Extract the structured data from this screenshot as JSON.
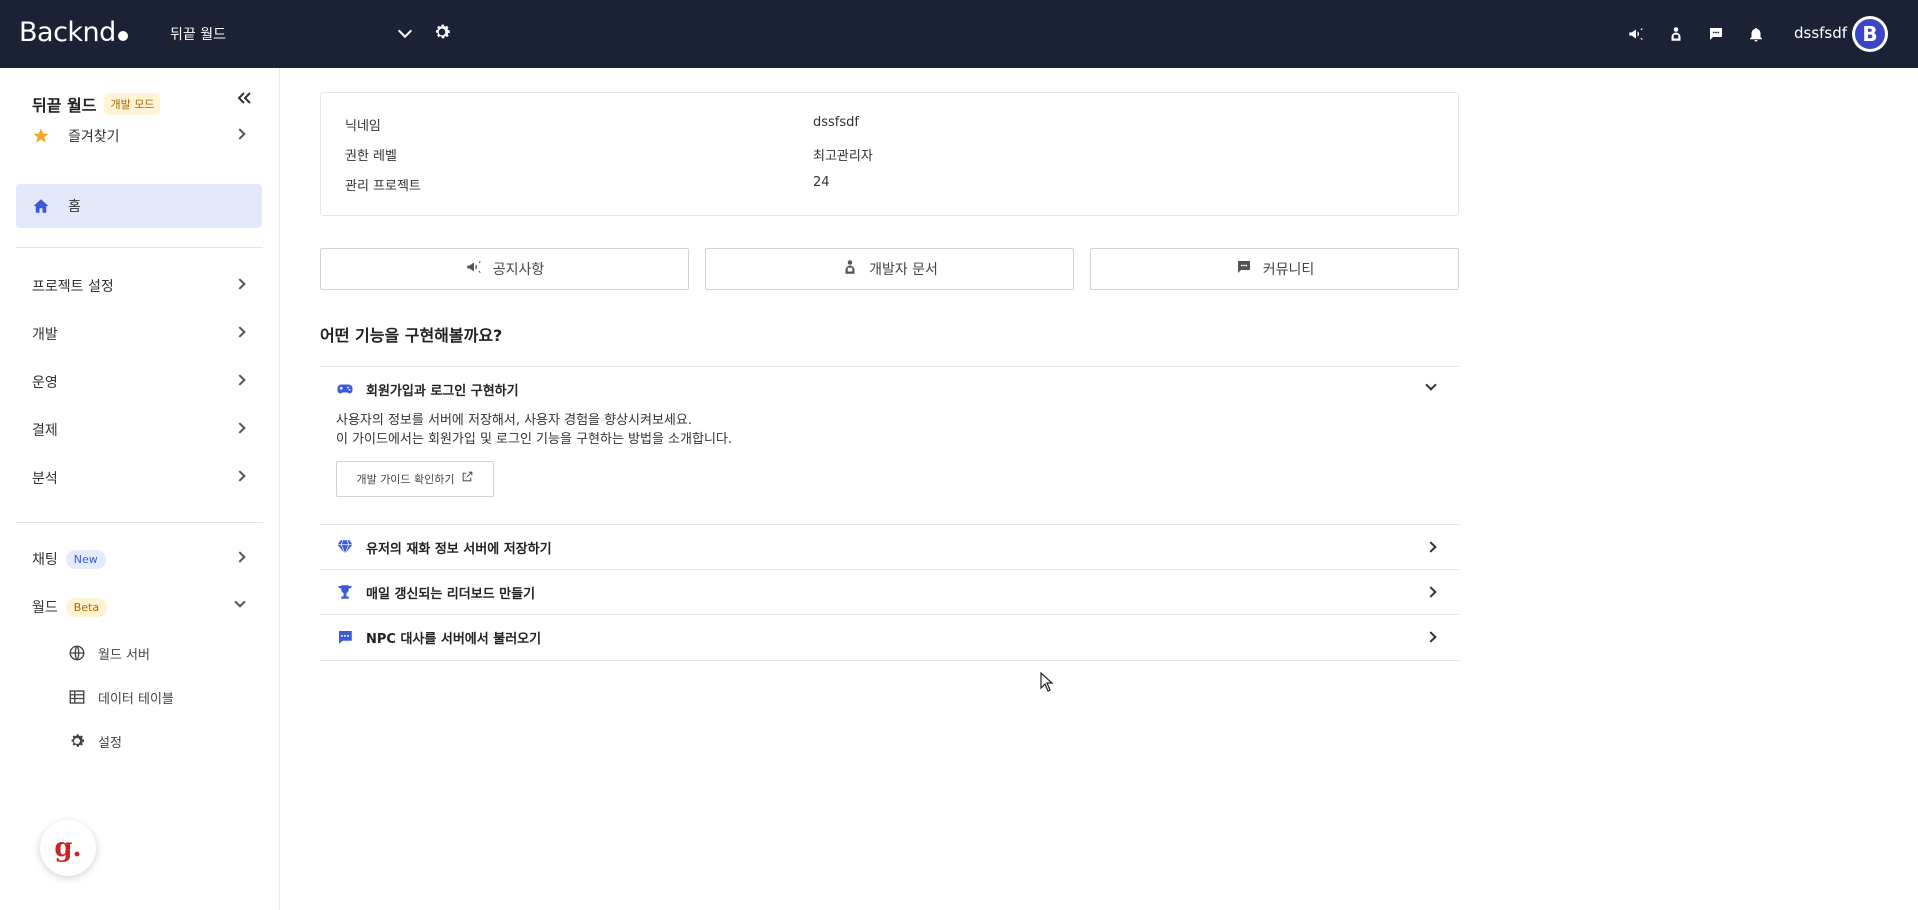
{
  "header": {
    "logo": "Backnd",
    "project_name": "뒤끝 월드",
    "username": "dssfsdf",
    "avatar_letter": "B",
    "icons": [
      "megaphone-icon",
      "developer-docs-icon",
      "chat-icon",
      "bell-icon"
    ]
  },
  "sidebar": {
    "title": "뒤끝 월드",
    "mode_badge": "개발 모드",
    "items": [
      {
        "label": "즐겨찾기",
        "icon": "star-icon"
      },
      {
        "label": "홈",
        "icon": "home-icon"
      },
      {
        "label": "프로젝트 설정"
      },
      {
        "label": "개발"
      },
      {
        "label": "운영"
      },
      {
        "label": "결제"
      },
      {
        "label": "분석"
      },
      {
        "label": "채팅",
        "badge": "New"
      },
      {
        "label": "월드",
        "badge": "Beta"
      }
    ],
    "world_sub": [
      {
        "label": "월드 서버",
        "icon": "globe-icon"
      },
      {
        "label": "데이터 테이블",
        "icon": "table-icon"
      },
      {
        "label": "설정",
        "icon": "gear-icon"
      }
    ],
    "help_label": "g."
  },
  "profile": {
    "rows": [
      {
        "key": "닉네임",
        "value": "dssfsdf"
      },
      {
        "key": "권한 레벨",
        "value": "최고관리자"
      },
      {
        "key": "관리 프로젝트",
        "value": "24"
      }
    ]
  },
  "links": {
    "notice": "공지사항",
    "docs": "개발자 문서",
    "community": "커뮤니티"
  },
  "features": {
    "title": "어떤 기능을 구현해볼까요?",
    "items": [
      {
        "title": "회원가입과 로그인 구현하기",
        "icon": "gamepad-icon",
        "desc1": "사용자의 정보를 서버에 저장해서, 사용자 경험을 향상시켜보세요.",
        "desc2": "이 가이드에서는 회원가입 및 로그인 기능을 구현하는 방법을 소개합니다.",
        "button": "개발 가이드 확인하기"
      },
      {
        "title": "유저의 재화 정보 서버에 저장하기",
        "icon": "diamond-icon"
      },
      {
        "title": "매일 갱신되는 리더보드 만들기",
        "icon": "trophy-icon"
      },
      {
        "title": "NPC 대사를 서버에서 불러오기",
        "icon": "dialog-icon"
      }
    ]
  },
  "colors": {
    "header_bg": "#1b2236",
    "accent": "#3b5bdb",
    "active_bg": "#e3e9fb",
    "star": "#f5a623"
  }
}
